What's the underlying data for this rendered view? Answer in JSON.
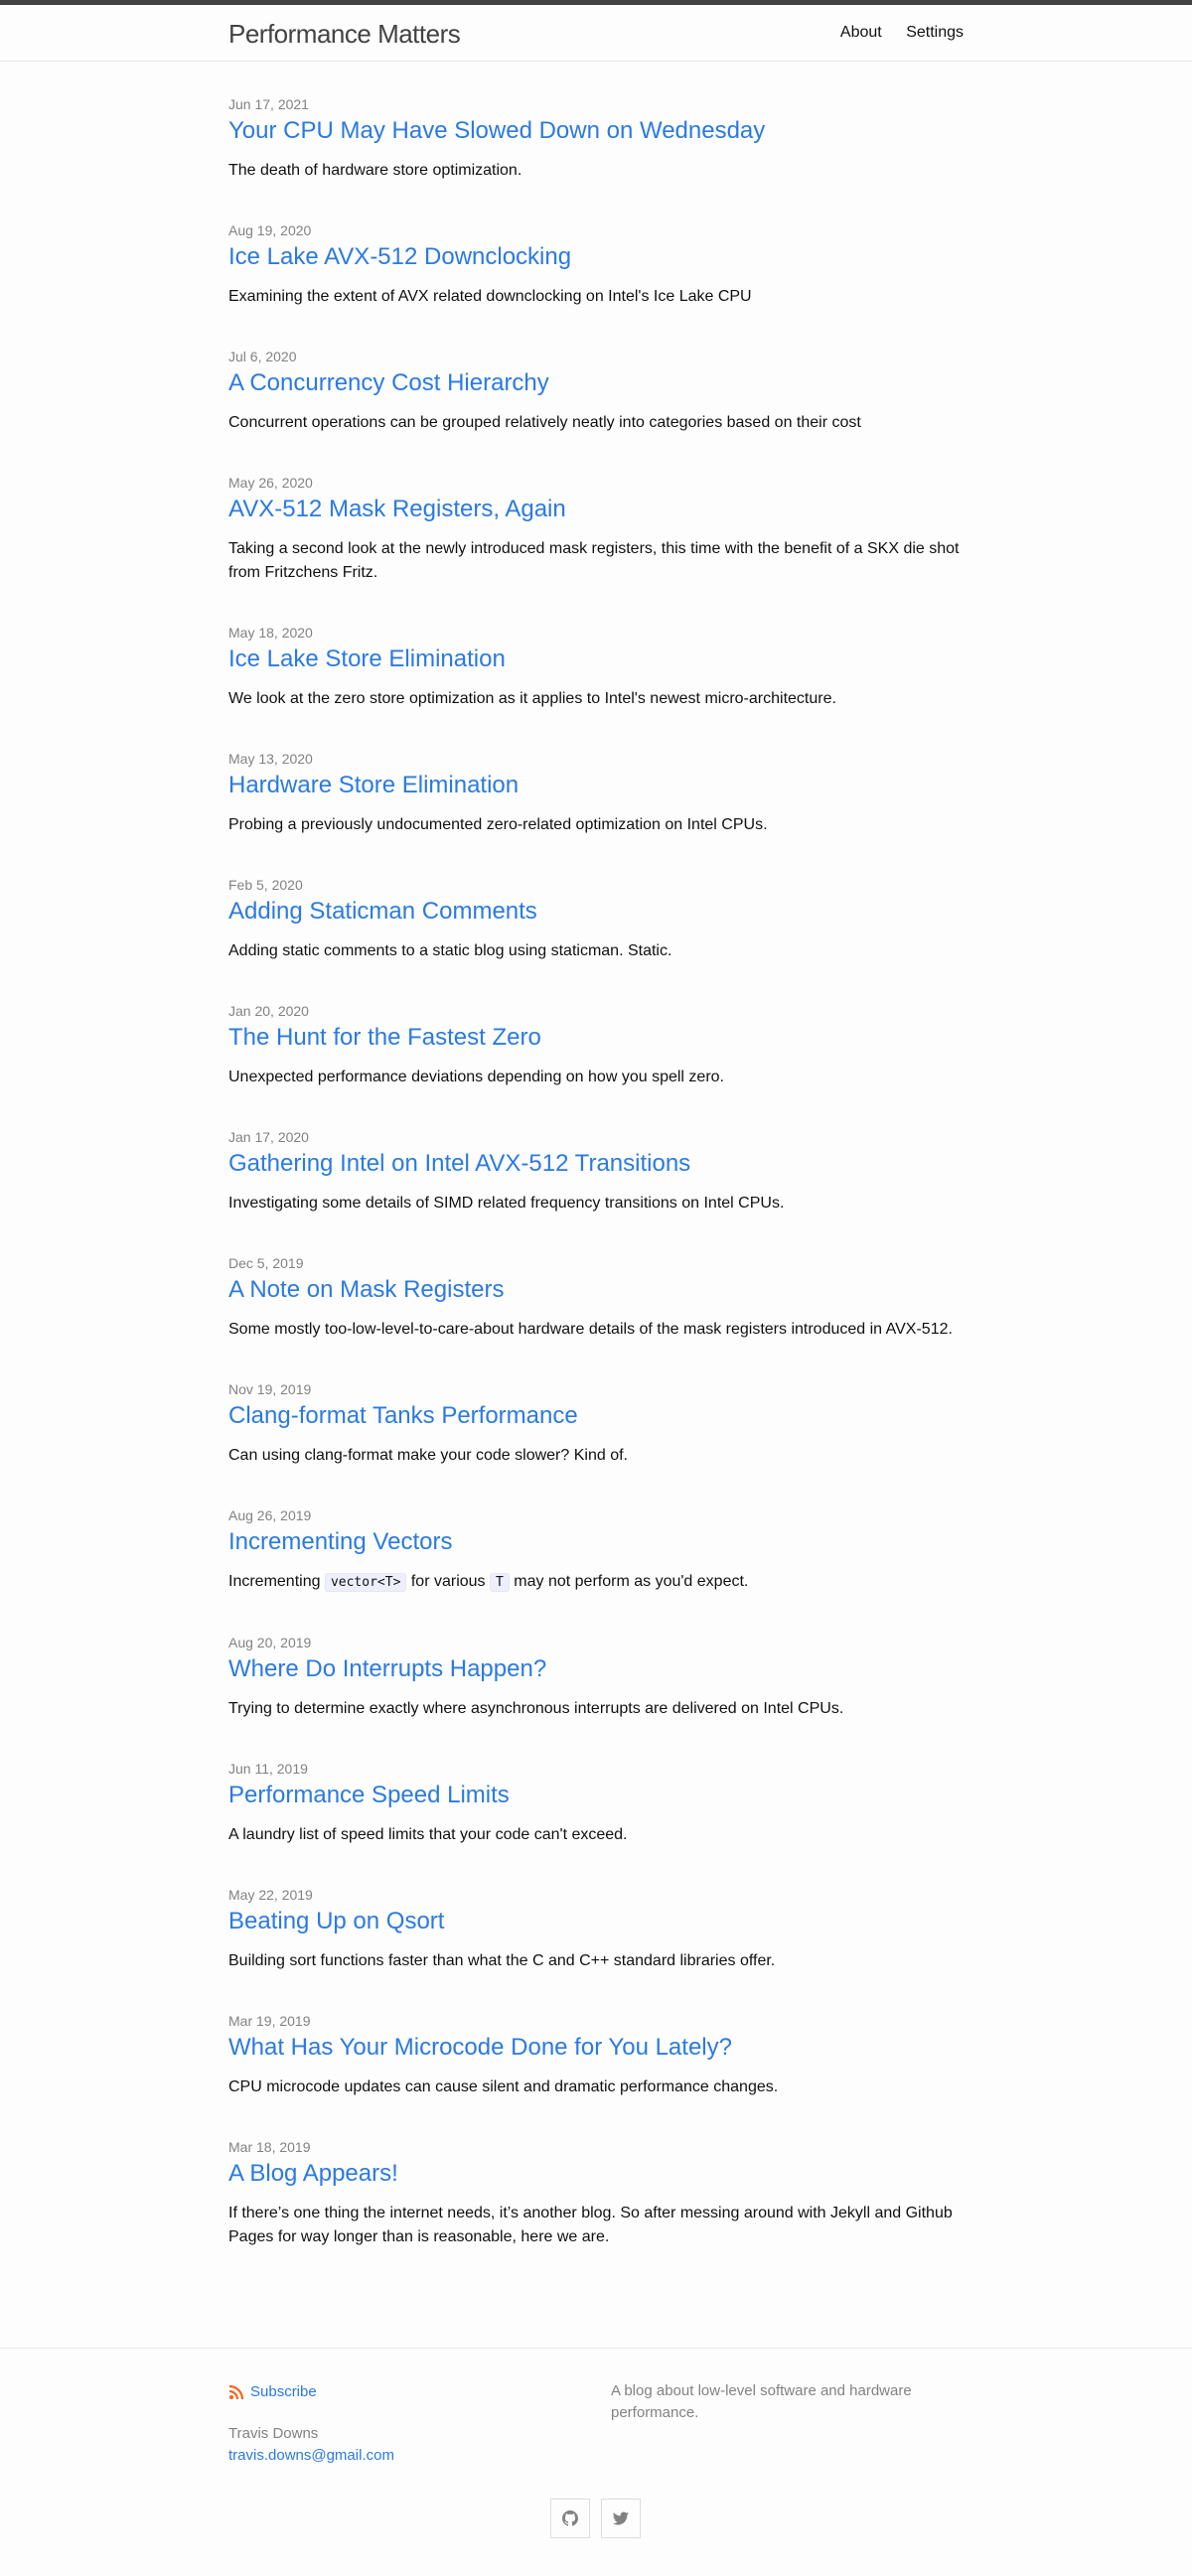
{
  "site": {
    "title": "Performance Matters"
  },
  "nav": {
    "about": "About",
    "settings": "Settings"
  },
  "posts": [
    {
      "date": "Jun 17, 2021",
      "title": "Your CPU May Have Slowed Down on Wednesday",
      "excerpt": "The death of hardware store optimization."
    },
    {
      "date": "Aug 19, 2020",
      "title": "Ice Lake AVX-512 Downclocking",
      "excerpt": "Examining the extent of AVX related downclocking on Intel's Ice Lake CPU"
    },
    {
      "date": "Jul 6, 2020",
      "title": "A Concurrency Cost Hierarchy",
      "excerpt": "Concurrent operations can be grouped relatively neatly into categories based on their cost"
    },
    {
      "date": "May 26, 2020",
      "title": "AVX-512 Mask Registers, Again",
      "excerpt": "Taking a second look at the newly introduced mask registers, this time with the benefit of a SKX die shot from Fritzchens Fritz."
    },
    {
      "date": "May 18, 2020",
      "title": "Ice Lake Store Elimination",
      "excerpt": "We look at the zero store optimization as it applies to Intel's newest micro-architecture."
    },
    {
      "date": "May 13, 2020",
      "title": "Hardware Store Elimination",
      "excerpt": "Probing a previously undocumented zero-related optimization on Intel CPUs."
    },
    {
      "date": "Feb 5, 2020",
      "title": "Adding Staticman Comments",
      "excerpt": "Adding static comments to a static blog using staticman. Static."
    },
    {
      "date": "Jan 20, 2020",
      "title": "The Hunt for the Fastest Zero",
      "excerpt": "Unexpected performance deviations depending on how you spell zero."
    },
    {
      "date": "Jan 17, 2020",
      "title": "Gathering Intel on Intel AVX-512 Transitions",
      "excerpt": "Investigating some details of SIMD related frequency transitions on Intel CPUs."
    },
    {
      "date": "Dec 5, 2019",
      "title": "A Note on Mask Registers",
      "excerpt": "Some mostly too-low-level-to-care-about hardware details of the mask registers introduced in AVX-512."
    },
    {
      "date": "Nov 19, 2019",
      "title": "Clang-format Tanks Performance",
      "excerpt": "Can using clang-format make your code slower? Kind of."
    },
    {
      "date": "Aug 26, 2019",
      "title": "Incrementing Vectors",
      "excerpt_parts": {
        "a": "Incrementing",
        "code1": "vector<T>",
        "b": "for various",
        "code2": "T",
        "c": "may not perform as you'd expect."
      }
    },
    {
      "date": "Aug 20, 2019",
      "title": "Where Do Interrupts Happen?",
      "excerpt": "Trying to determine exactly where asynchronous interrupts are delivered on Intel CPUs."
    },
    {
      "date": "Jun 11, 2019",
      "title": "Performance Speed Limits",
      "excerpt": "A laundry list of speed limits that your code can't exceed."
    },
    {
      "date": "May 22, 2019",
      "title": "Beating Up on Qsort",
      "excerpt": "Building sort functions faster than what the C and C++ standard libraries offer."
    },
    {
      "date": "Mar 19, 2019",
      "title": "What Has Your Microcode Done for You Lately?",
      "excerpt": "CPU microcode updates can cause silent and dramatic performance changes."
    },
    {
      "date": "Mar 18, 2019",
      "title": "A Blog Appears!",
      "excerpt": "If there’s one thing the internet needs, it’s another blog. So after messing around with Jekyll and Github Pages for way longer than is reasonable, here we are."
    }
  ],
  "footer": {
    "subscribe": "Subscribe",
    "author": "Travis Downs",
    "email": "travis.downs@gmail.com",
    "description": "A blog about low-level software and hardware performance."
  },
  "icons": {
    "rss": "rss-icon",
    "github": "github-icon",
    "twitter": "twitter-icon"
  },
  "colors": {
    "link": "#2a7ae2",
    "rss": "#f26522",
    "meta": "#828282"
  }
}
